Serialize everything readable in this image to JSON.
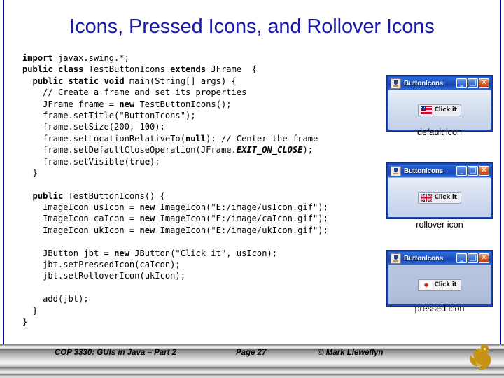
{
  "slide": {
    "title": "Icons, Pressed Icons, and Rollover Icons",
    "title_color": "#1a1aa8",
    "edge_rule_color": "#00009c"
  },
  "code": {
    "language": "java",
    "lines": [
      [
        {
          "t": "import",
          "b": true
        },
        {
          "t": " javax.swing.*;",
          "b": false
        }
      ],
      [
        {
          "t": "public class",
          "b": true
        },
        {
          "t": " TestButtonIcons ",
          "b": false
        },
        {
          "t": "extends",
          "b": true
        },
        {
          "t": " JFrame  {",
          "b": false
        }
      ],
      [
        {
          "t": "  public static void",
          "b": true
        },
        {
          "t": " main(String[] args) {",
          "b": false
        }
      ],
      [
        {
          "t": "    // Create a frame and set its properties",
          "b": false
        }
      ],
      [
        {
          "t": "    JFrame frame = ",
          "b": false
        },
        {
          "t": "new",
          "b": true
        },
        {
          "t": " TestButtonIcons();",
          "b": false
        }
      ],
      [
        {
          "t": "    frame.setTitle(\"ButtonIcons\");",
          "b": false
        }
      ],
      [
        {
          "t": "    frame.setSize(200, 100);",
          "b": false
        }
      ],
      [
        {
          "t": "    frame.setLocationRelativeTo(",
          "b": false
        },
        {
          "t": "null",
          "b": true
        },
        {
          "t": "); // Center the frame",
          "b": false
        }
      ],
      [
        {
          "t": "    frame.setDefaultCloseOperation(JFrame.",
          "b": false
        },
        {
          "t": "EXIT_ON_CLOSE",
          "i": true
        },
        {
          "t": ");",
          "b": false
        }
      ],
      [
        {
          "t": "    frame.setVisible(",
          "b": false
        },
        {
          "t": "true",
          "b": true
        },
        {
          "t": ");",
          "b": false
        }
      ],
      [
        {
          "t": "  }",
          "b": false
        }
      ],
      [
        {
          "t": "",
          "b": false
        }
      ],
      [
        {
          "t": "  public",
          "b": true
        },
        {
          "t": " TestButtonIcons() {",
          "b": false
        }
      ],
      [
        {
          "t": "    ImageIcon usIcon = ",
          "b": false
        },
        {
          "t": "new",
          "b": true
        },
        {
          "t": " ImageIcon(\"E:/image/usIcon.gif\");",
          "b": false
        }
      ],
      [
        {
          "t": "    ImageIcon caIcon = ",
          "b": false
        },
        {
          "t": "new",
          "b": true
        },
        {
          "t": " ImageIcon(\"E:/image/caIcon.gif\");",
          "b": false
        }
      ],
      [
        {
          "t": "    ImageIcon ukIcon = ",
          "b": false
        },
        {
          "t": "new",
          "b": true
        },
        {
          "t": " ImageIcon(\"E:/image/ukIcon.gif\");",
          "b": false
        }
      ],
      [
        {
          "t": "",
          "b": false
        }
      ],
      [
        {
          "t": "    JButton jbt = ",
          "b": false
        },
        {
          "t": "new",
          "b": true
        },
        {
          "t": " JButton(\"Click it\", usIcon);",
          "b": false
        }
      ],
      [
        {
          "t": "    jbt.setPressedIcon(caIcon);",
          "b": false
        }
      ],
      [
        {
          "t": "    jbt.setRolloverIcon(ukIcon);",
          "b": false
        }
      ],
      [
        {
          "t": "",
          "b": false
        }
      ],
      [
        {
          "t": "    add(jbt);",
          "b": false
        }
      ],
      [
        {
          "t": "  }",
          "b": false
        }
      ],
      [
        {
          "t": "}",
          "b": false
        }
      ]
    ]
  },
  "demo_windows": [
    {
      "window_title": "ButtonIcons",
      "button_label": "Click it",
      "flag": "us-flag",
      "state": "default",
      "caption": "default icon",
      "min_glyph": "_",
      "max_glyph": "□",
      "close_glyph": "✕"
    },
    {
      "window_title": "ButtonIcons",
      "button_label": "Click it",
      "flag": "uk-flag",
      "state": "rollover",
      "caption": "rollover icon",
      "min_glyph": "_",
      "max_glyph": "□",
      "close_glyph": "✕"
    },
    {
      "window_title": "ButtonIcons",
      "button_label": "Click it",
      "flag": "ca-flag",
      "state": "pressed",
      "caption": "pressed icon",
      "min_glyph": "_",
      "max_glyph": "□",
      "close_glyph": "✕"
    }
  ],
  "footer": {
    "course": "COP 3330:  GUIs in Java – Part 2",
    "page": "Page 27",
    "copyright": "© Mark Llewellyn",
    "logo": "ucf-pegasus-logo"
  }
}
